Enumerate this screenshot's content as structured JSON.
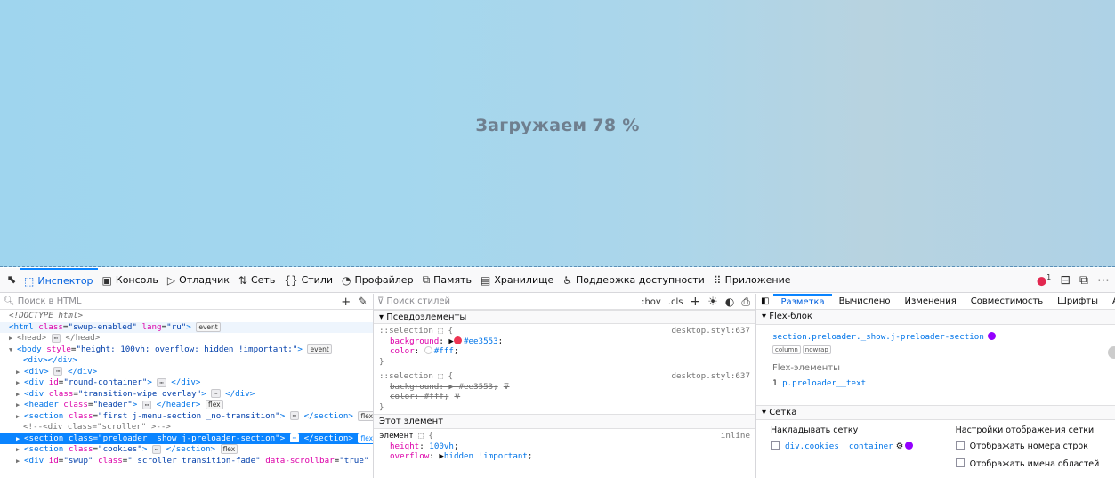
{
  "viewport": {
    "loading_text": "Загружаем",
    "loading_pct": "78 %"
  },
  "toolbar": {
    "tabs": [
      {
        "icon": "⬚",
        "label": "Инспектор"
      },
      {
        "icon": "▣",
        "label": "Консоль"
      },
      {
        "icon": "▷",
        "label": "Отладчик"
      },
      {
        "icon": "⇅",
        "label": "Сеть"
      },
      {
        "icon": "{}",
        "label": "Стили"
      },
      {
        "icon": "◔",
        "label": "Профайлер"
      },
      {
        "icon": "⧉",
        "label": "Память"
      },
      {
        "icon": "▤",
        "label": "Хранилище"
      },
      {
        "icon": "♿",
        "label": "Поддержка доступности"
      },
      {
        "icon": "⠿",
        "label": "Приложение"
      }
    ],
    "error_count": "1"
  },
  "html_panel": {
    "search_placeholder": "Поиск в HTML"
  },
  "rules_panel": {
    "search_placeholder": "Поиск стилей",
    "hov": ":hov",
    "cls": ".cls",
    "pseudo_header": "Псевдоэлементы",
    "rule1": {
      "selector": "::selection",
      "source": "desktop.styl:637",
      "bg_name": "background",
      "bg_value": "#ee3553",
      "color_name": "color",
      "color_value": "#fff"
    },
    "rule2": {
      "selector": "::selection",
      "source": "desktop.styl:637",
      "bg_name": "background",
      "bg_value": "#ee3553",
      "color_name": "color",
      "color_value": "#fff"
    },
    "element_header": "Этот элемент",
    "rule3": {
      "selector": "элемент",
      "source": "inline",
      "h_name": "height",
      "h_value": "100vh",
      "o_name": "overflow",
      "o_value": "hidden !important"
    }
  },
  "layout_panel": {
    "tabs": [
      "Разметка",
      "Вычислено",
      "Изменения",
      "Совместимость",
      "Шрифты",
      "Аним"
    ],
    "flex_header": "Flex-блок",
    "flex_selector": "section.preloader._show.j-preloader-section",
    "flex_badges": [
      "column",
      "nowrap"
    ],
    "flex_items_label": "Flex-элементы",
    "flex_item_index": "1",
    "flex_item": "p.preloader__text",
    "grid_header": "Сетка",
    "overlay_title": "Накладывать сетку",
    "overlay_item": "div.cookies__container",
    "settings_title": "Настройки отображения сетки",
    "setting_1": "Отображать номера строк",
    "setting_2": "Отображать имена областей"
  },
  "colors": {
    "accent": "#0a84ff",
    "selection_red": "#ee3553",
    "grid_purple": "#9400ff"
  }
}
